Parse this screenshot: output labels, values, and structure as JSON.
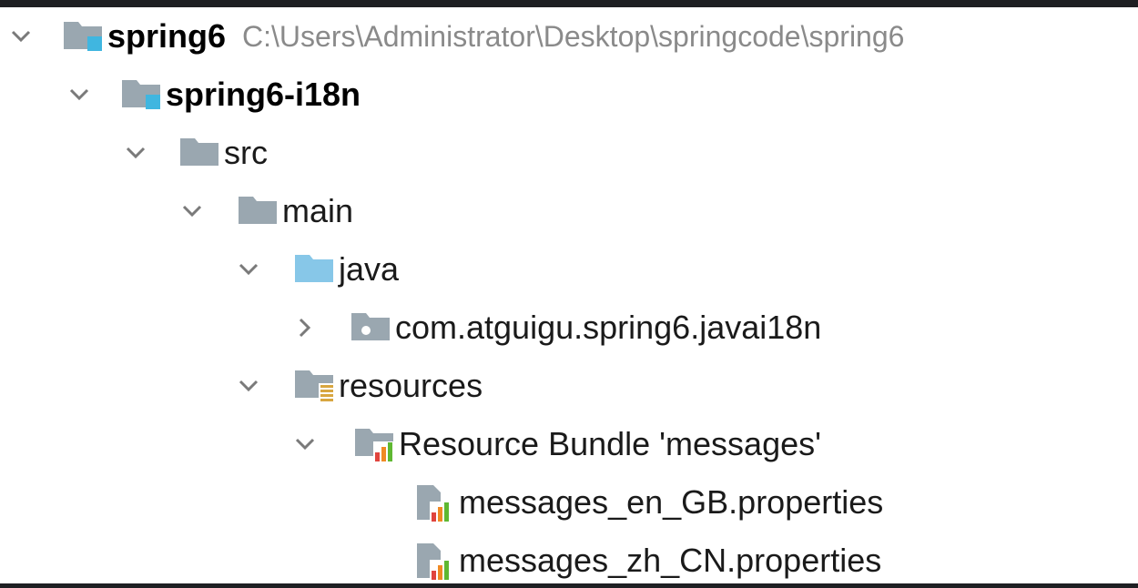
{
  "tree": {
    "root": {
      "label": "spring6",
      "path": "C:\\Users\\Administrator\\Desktop\\springcode\\spring6",
      "icon": "module-folder-icon",
      "expanded": true
    },
    "module": {
      "label": "spring6-i18n",
      "icon": "module-folder-icon",
      "expanded": true
    },
    "src": {
      "label": "src",
      "icon": "folder-icon",
      "expanded": true
    },
    "main": {
      "label": "main",
      "icon": "folder-icon",
      "expanded": true
    },
    "java": {
      "label": "java",
      "icon": "source-root-folder-icon",
      "expanded": true
    },
    "package": {
      "label": "com.atguigu.spring6.javai18n",
      "icon": "package-icon",
      "expanded": false
    },
    "resources": {
      "label": "resources",
      "icon": "resources-root-icon",
      "expanded": true
    },
    "bundle": {
      "label": "Resource Bundle 'messages'",
      "icon": "resource-bundle-icon",
      "expanded": true
    },
    "files": [
      {
        "label": "messages_en_GB.properties",
        "icon": "properties-file-icon"
      },
      {
        "label": "messages_zh_CN.properties",
        "icon": "properties-file-icon"
      }
    ]
  },
  "colors": {
    "folder": "#9aa7b0",
    "source_root": "#87c7e8",
    "module_badge": "#40b6e0",
    "resources_lines": "#d8a640",
    "bundle_orange": "#f08a24",
    "bundle_green": "#5fb832",
    "bundle_red": "#e0443e"
  }
}
